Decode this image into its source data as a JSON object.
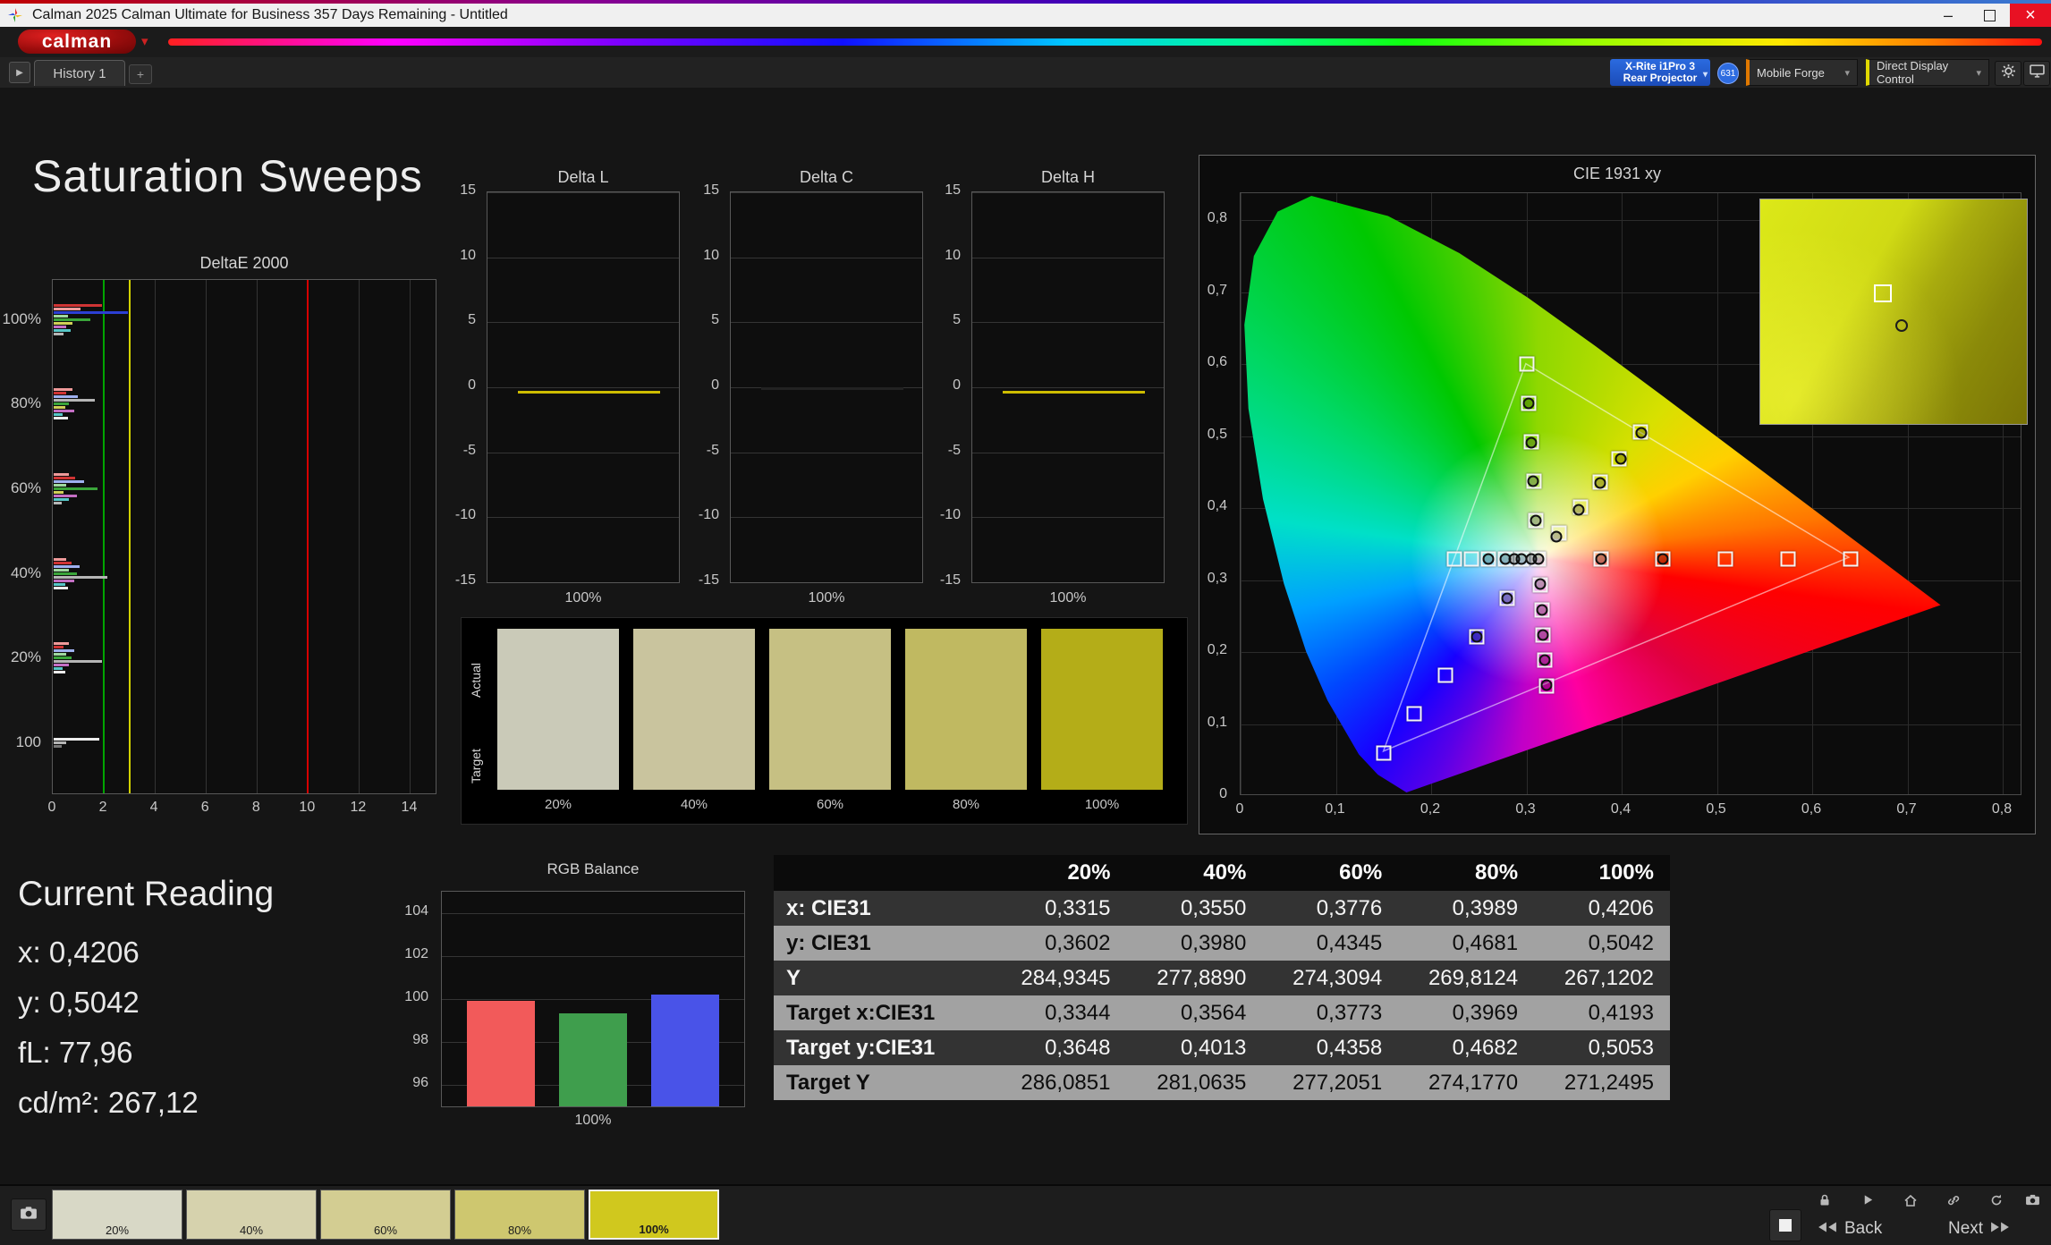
{
  "window": {
    "title": "Calman 2025 Calman Ultimate for Business 357 Days Remaining  - Untitled"
  },
  "brand": {
    "logo_text": "calman"
  },
  "toolbar": {
    "history_tab": "History 1",
    "add_tab": "+",
    "meter": {
      "line1": "X-Rite i1Pro 3",
      "line2": "Rear Projector"
    },
    "badge": "631",
    "source": "Mobile Forge",
    "display_control": "Direct Display Control"
  },
  "page_title": "Saturation Sweeps",
  "current_reading": {
    "title": "Current Reading",
    "x": "x: 0,4206",
    "y": "y: 0,5042",
    "fl": "fL: 77,96",
    "cdm2": "cd/m²: 267,12"
  },
  "swatch_panel": {
    "row_labels": [
      "Actual",
      "Target"
    ],
    "levels": [
      "20%",
      "40%",
      "60%",
      "80%",
      "100%"
    ],
    "colors": [
      "#cacab8",
      "#c9c49e",
      "#c6c083",
      "#c0b961",
      "#b4ad18"
    ]
  },
  "results_table": {
    "columns": [
      "",
      "20%",
      "40%",
      "60%",
      "80%",
      "100%"
    ],
    "rows": [
      {
        "label": "x: CIE31",
        "values": [
          "0,3315",
          "0,3550",
          "0,3776",
          "0,3989",
          "0,4206"
        ]
      },
      {
        "label": "y: CIE31",
        "values": [
          "0,3602",
          "0,3980",
          "0,4345",
          "0,4681",
          "0,5042"
        ]
      },
      {
        "label": "Y",
        "values": [
          "284,9345",
          "277,8890",
          "274,3094",
          "269,8124",
          "267,1202"
        ]
      },
      {
        "label": "Target x:CIE31",
        "values": [
          "0,3344",
          "0,3564",
          "0,3773",
          "0,3969",
          "0,4193"
        ]
      },
      {
        "label": "Target y:CIE31",
        "values": [
          "0,3648",
          "0,4013",
          "0,4358",
          "0,4682",
          "0,5053"
        ]
      },
      {
        "label": "Target Y",
        "values": [
          "286,0851",
          "281,0635",
          "277,2051",
          "274,1770",
          "271,2495"
        ]
      }
    ]
  },
  "bottom_bar": {
    "thumbnails": [
      {
        "label": "20%",
        "color": "#d8d8c6",
        "selected": false
      },
      {
        "label": "40%",
        "color": "#d6d2ad",
        "selected": false
      },
      {
        "label": "60%",
        "color": "#d3cd92",
        "selected": false
      },
      {
        "label": "80%",
        "color": "#cec76f",
        "selected": false
      },
      {
        "label": "100%",
        "color": "#d0c81e",
        "selected": true
      }
    ],
    "back_label": "Back",
    "next_label": "Next"
  },
  "chart_data": [
    {
      "id": "deltaE",
      "type": "bar",
      "orientation": "horizontal",
      "title": "DeltaE 2000",
      "xlim": [
        0,
        15
      ],
      "xticks": [
        0,
        2,
        4,
        6,
        8,
        10,
        12,
        14
      ],
      "row_labels": [
        "100%",
        "80%",
        "60%",
        "40%",
        "20%",
        "100"
      ],
      "reference_lines": [
        {
          "value": 2,
          "color": "#00a400"
        },
        {
          "value": 3,
          "color": "#d2d200"
        },
        {
          "value": 10,
          "color": "#d40000"
        }
      ],
      "groups": [
        {
          "label": "100%",
          "bars": [
            {
              "v": 1.9,
              "c": "#cf3434"
            },
            {
              "v": 1.05,
              "c": "#ef9a9a"
            },
            {
              "v": 2.9,
              "c": "#2c3fd4"
            },
            {
              "v": 0.55,
              "c": "#9fd89f"
            },
            {
              "v": 1.45,
              "c": "#3aa53a"
            },
            {
              "v": 0.75,
              "c": "#cfcf57"
            },
            {
              "v": 0.5,
              "c": "#c46fc4"
            },
            {
              "v": 0.65,
              "c": "#57c7c7"
            },
            {
              "v": 0.4,
              "c": "#b5b5b5"
            }
          ]
        },
        {
          "label": "80%",
          "bars": [
            {
              "v": 0.75,
              "c": "#ef9a9a"
            },
            {
              "v": 0.5,
              "c": "#cf3434"
            },
            {
              "v": 0.95,
              "c": "#9fb0ef"
            },
            {
              "v": 1.6,
              "c": "#b5b5b5"
            },
            {
              "v": 0.6,
              "c": "#3aa53a"
            },
            {
              "v": 0.45,
              "c": "#cfcf57"
            },
            {
              "v": 0.8,
              "c": "#c46fc4"
            },
            {
              "v": 0.35,
              "c": "#57c7c7"
            },
            {
              "v": 0.55,
              "c": "#ececec"
            }
          ]
        },
        {
          "label": "60%",
          "bars": [
            {
              "v": 0.6,
              "c": "#ef9a9a"
            },
            {
              "v": 0.85,
              "c": "#cf3434"
            },
            {
              "v": 1.2,
              "c": "#9fb0ef"
            },
            {
              "v": 0.5,
              "c": "#9fd89f"
            },
            {
              "v": 1.7,
              "c": "#3aa53a"
            },
            {
              "v": 0.4,
              "c": "#cfcf57"
            },
            {
              "v": 0.9,
              "c": "#c46fc4"
            },
            {
              "v": 0.6,
              "c": "#57c7c7"
            },
            {
              "v": 0.3,
              "c": "#b5b5b5"
            }
          ]
        },
        {
          "label": "40%",
          "bars": [
            {
              "v": 0.5,
              "c": "#ef9a9a"
            },
            {
              "v": 0.7,
              "c": "#cf3434"
            },
            {
              "v": 1.0,
              "c": "#9fb0ef"
            },
            {
              "v": 0.6,
              "c": "#9fd89f"
            },
            {
              "v": 0.9,
              "c": "#3aa53a"
            },
            {
              "v": 2.1,
              "c": "#b5b5b5"
            },
            {
              "v": 0.8,
              "c": "#c46fc4"
            },
            {
              "v": 0.45,
              "c": "#57c7c7"
            },
            {
              "v": 0.55,
              "c": "#ececec"
            }
          ]
        },
        {
          "label": "20%",
          "bars": [
            {
              "v": 0.6,
              "c": "#ef9a9a"
            },
            {
              "v": 0.4,
              "c": "#cf3434"
            },
            {
              "v": 0.8,
              "c": "#9fb0ef"
            },
            {
              "v": 0.5,
              "c": "#9fd89f"
            },
            {
              "v": 0.7,
              "c": "#3aa53a"
            },
            {
              "v": 1.9,
              "c": "#b5b5b5"
            },
            {
              "v": 0.6,
              "c": "#c46fc4"
            },
            {
              "v": 0.35,
              "c": "#57c7c7"
            },
            {
              "v": 0.45,
              "c": "#ececec"
            }
          ]
        },
        {
          "label": "100",
          "bars": [
            {
              "v": 1.8,
              "c": "#ececec"
            },
            {
              "v": 0.5,
              "c": "#b5b5b5"
            },
            {
              "v": 0.3,
              "c": "#777777"
            }
          ]
        }
      ]
    },
    {
      "id": "deltaL",
      "type": "line",
      "title": "Delta L",
      "ylim": [
        -15,
        15
      ],
      "yticks": [
        15,
        10,
        5,
        0,
        -5,
        -10,
        -15
      ],
      "xlabel": "100%",
      "value": -0.4,
      "color": "#cdbc00"
    },
    {
      "id": "deltaC",
      "type": "line",
      "title": "Delta C",
      "ylim": [
        -15,
        15
      ],
      "yticks": [
        15,
        10,
        5,
        0,
        -5,
        -10,
        -15
      ],
      "xlabel": "100%",
      "value": -0.1,
      "color": "#222222"
    },
    {
      "id": "deltaH",
      "type": "line",
      "title": "Delta H",
      "ylim": [
        -15,
        15
      ],
      "yticks": [
        15,
        10,
        5,
        0,
        -5,
        -10,
        -15
      ],
      "xlabel": "100%",
      "value": -0.4,
      "color": "#cdbc00"
    },
    {
      "id": "rgb",
      "type": "bar",
      "title": "RGB Balance",
      "categories": [
        "Red",
        "Green",
        "Blue"
      ],
      "values": [
        99.9,
        99.35,
        100.2
      ],
      "colors": [
        "#f25a5a",
        "#3f9e4d",
        "#4953e8"
      ],
      "ylim": [
        95,
        105
      ],
      "yticks": [
        96,
        98,
        100,
        102,
        104
      ],
      "xlabel": "100%"
    },
    {
      "id": "cie",
      "type": "scatter",
      "title": "CIE 1931 xy",
      "xlim": [
        0,
        0.8
      ],
      "ylim": [
        0,
        0.8
      ],
      "xtick_labels": [
        "0",
        "0,1",
        "0,2",
        "0,3",
        "0,4",
        "0,5",
        "0,6",
        "0,7",
        "0,8"
      ],
      "ytick_labels": [
        "0",
        "0,1",
        "0,2",
        "0,3",
        "0,4",
        "0,5",
        "0,6",
        "0,7",
        "0,8"
      ],
      "gamut_triangle": [
        [
          0.64,
          0.33
        ],
        [
          0.3,
          0.6
        ],
        [
          0.15,
          0.06
        ]
      ],
      "white_point": [
        0.3127,
        0.329
      ],
      "targets": [
        [
          0.3344,
          0.3648
        ],
        [
          0.3564,
          0.4013
        ],
        [
          0.3773,
          0.4358
        ],
        [
          0.3969,
          0.4682
        ],
        [
          0.4193,
          0.5053
        ],
        [
          0.3781,
          0.329
        ],
        [
          0.4436,
          0.3289
        ],
        [
          0.509,
          0.3289
        ],
        [
          0.5745,
          0.3289
        ],
        [
          0.64,
          0.329
        ],
        [
          0.3102,
          0.3832
        ],
        [
          0.3076,
          0.4374
        ],
        [
          0.3051,
          0.4916
        ],
        [
          0.3025,
          0.5458
        ],
        [
          0.3,
          0.6
        ],
        [
          0.2802,
          0.2752
        ],
        [
          0.2476,
          0.2214
        ],
        [
          0.2151,
          0.1676
        ],
        [
          0.1825,
          0.1138
        ],
        [
          0.15,
          0.06
        ],
        [
          0.3143,
          0.2938
        ],
        [
          0.316,
          0.2587
        ],
        [
          0.3176,
          0.2235
        ],
        [
          0.3192,
          0.1884
        ],
        [
          0.3209,
          0.1532
        ],
        [
          0.2951,
          0.3289
        ],
        [
          0.2775,
          0.3288
        ],
        [
          0.2599,
          0.3288
        ],
        [
          0.2423,
          0.3287
        ],
        [
          0.2246,
          0.3287
        ],
        [
          0.3127,
          0.329
        ]
      ],
      "measured": [
        [
          0.3315,
          0.3602
        ],
        [
          0.355,
          0.398
        ],
        [
          0.3776,
          0.4345
        ],
        [
          0.3989,
          0.4681
        ],
        [
          0.4206,
          0.5042
        ],
        [
          0.31,
          0.383
        ],
        [
          0.3075,
          0.4372
        ],
        [
          0.305,
          0.4914
        ],
        [
          0.3028,
          0.5456
        ],
        [
          0.3145,
          0.294
        ],
        [
          0.3162,
          0.259
        ],
        [
          0.3178,
          0.2238
        ],
        [
          0.3195,
          0.1886
        ],
        [
          0.321,
          0.1535
        ],
        [
          0.378,
          0.3292
        ],
        [
          0.443,
          0.329
        ],
        [
          0.295,
          0.329
        ],
        [
          0.2776,
          0.3289
        ],
        [
          0.26,
          0.3288
        ],
        [
          0.287,
          0.329
        ],
        [
          0.305,
          0.329
        ],
        [
          0.28,
          0.275
        ],
        [
          0.2478,
          0.2216
        ],
        [
          0.313,
          0.3292
        ]
      ],
      "locus": [
        [
          0.1741,
          0.005
        ],
        [
          0.144,
          0.0297
        ],
        [
          0.1241,
          0.0578
        ],
        [
          0.0913,
          0.1327
        ],
        [
          0.0687,
          0.2007
        ],
        [
          0.0454,
          0.295
        ],
        [
          0.0235,
          0.4127
        ],
        [
          0.0082,
          0.5384
        ],
        [
          0.0039,
          0.6548
        ],
        [
          0.0139,
          0.7502
        ],
        [
          0.0389,
          0.812
        ],
        [
          0.0743,
          0.8338
        ],
        [
          0.1547,
          0.8059
        ],
        [
          0.2296,
          0.7543
        ],
        [
          0.3016,
          0.6923
        ],
        [
          0.3731,
          0.6245
        ],
        [
          0.4441,
          0.5547
        ],
        [
          0.5125,
          0.4866
        ],
        [
          0.5752,
          0.4242
        ],
        [
          0.627,
          0.3725
        ],
        [
          0.6658,
          0.334
        ],
        [
          0.6915,
          0.3083
        ],
        [
          0.7079,
          0.292
        ],
        [
          0.726,
          0.274
        ],
        [
          0.7347,
          0.2653
        ]
      ],
      "inset": {
        "square": [
          0.46,
          0.42
        ],
        "circle": [
          0.53,
          0.56
        ]
      }
    }
  ]
}
